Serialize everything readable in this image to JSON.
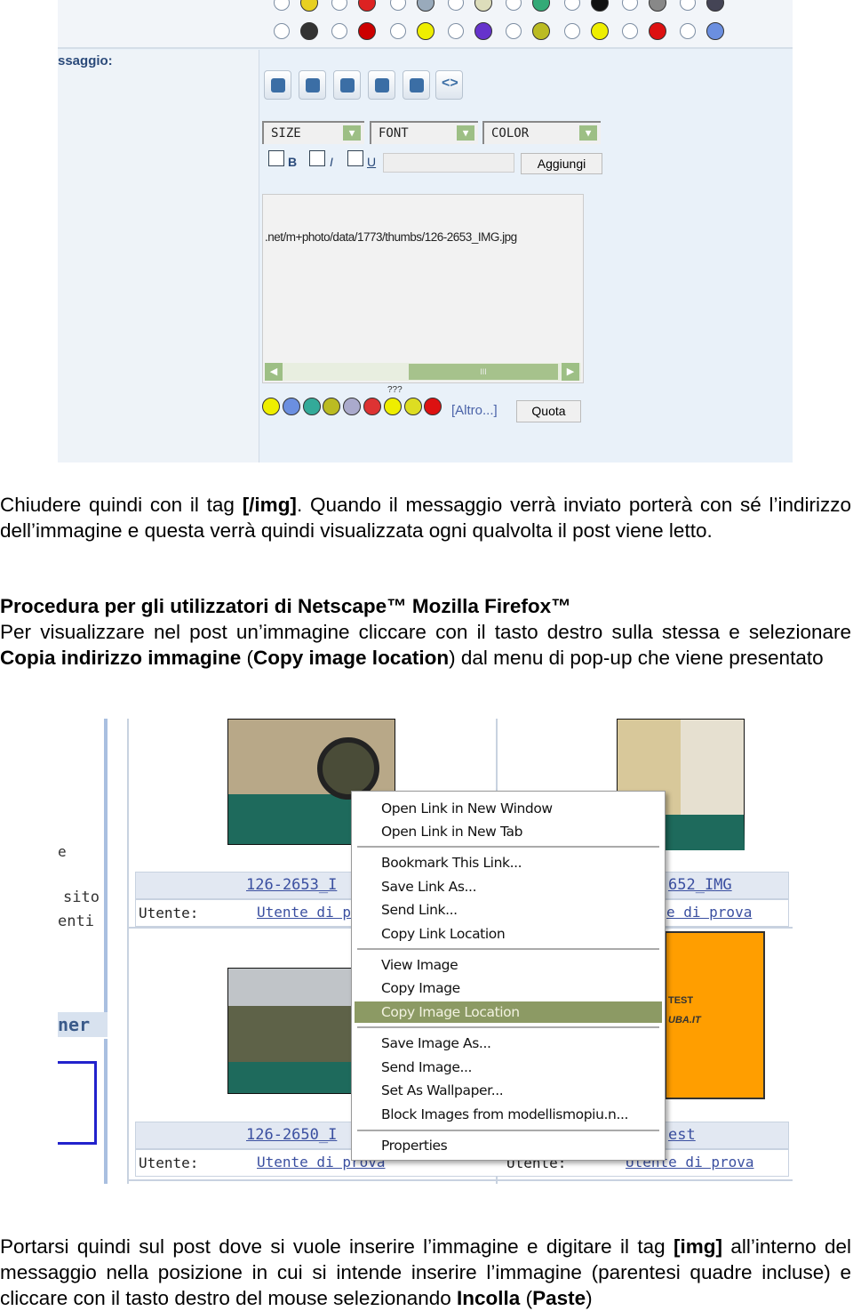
{
  "screenshot1": {
    "label": "ssaggio:",
    "selects": [
      "SIZE",
      "FONT",
      "COLOR"
    ],
    "format_checkboxes": [
      "B",
      "I",
      "U"
    ],
    "add_button": "Aggiungi",
    "textarea_value": ".net/m+photo/data/1773/thumbs/126-2653_IMG.jpg",
    "scroll_grip": "III",
    "more_smileys": "[Altro...]",
    "quote_button": "Quota",
    "smiley_tip": "???"
  },
  "paragraph1": {
    "t1": "Chiudere quindi con il tag ",
    "b1": "[/img]",
    "t2": ". Quando il messaggio verrà inviato porterà con sé l’indirizzo dell’immagine e questa verrà quindi visualizzata ogni qualvolta il post viene letto."
  },
  "section": {
    "heading": "Procedura per gli utilizzatori di Netscape™ Mozilla Firefox™",
    "t1": "Per visualizzare nel post un’immagine cliccare con il tasto destro sulla stessa e selezionare ",
    "b1": "Copia indirizzo immagine",
    "t2": " (",
    "b2": "Copy image location",
    "t3": ") dal menu di pop-up che viene presentato"
  },
  "screenshot2": {
    "sidebar_fragments": [
      "e",
      "sito",
      "enti",
      "ner"
    ],
    "gallery": [
      {
        "title": "126-2653_I",
        "user_label": "Utente:",
        "user": "Utente di pr"
      },
      {
        "title": "652_IMG",
        "user_label": "",
        "user": "e di prova"
      },
      {
        "title": "126-2650_I",
        "user_label": "Utente:",
        "user": "Utente di prova"
      },
      {
        "title": "est",
        "user_label": "Utente:",
        "user": "Utente di prova"
      }
    ],
    "banner_text": [
      "TEST",
      "UBA.IT"
    ],
    "context_menu": [
      "Open Link in New Window",
      "Open Link in New Tab",
      "Bookmark This Link...",
      "Save Link As...",
      "Send Link...",
      "Copy Link Location",
      "View Image",
      "Copy Image",
      "Copy Image Location",
      "Save Image As...",
      "Send Image...",
      "Set As Wallpaper...",
      "Block Images from modellismopiu.n...",
      "Properties"
    ],
    "highlighted_item": "Copy Image Location",
    "highlight_color": "#8c9a64"
  },
  "paragraph2": {
    "t1": "Portarsi quindi sul post dove si vuole inserire l’immagine e digitare il tag ",
    "b1": "[img]",
    "t2": " all’interno del messaggio nella posizione in cui si intende inserire l’immagine (parentesi quadre incluse) e cliccare con il tasto destro del mouse selezionando ",
    "b2": "Incolla",
    "t3": " (",
    "b3": "Paste",
    "t4": ")"
  }
}
